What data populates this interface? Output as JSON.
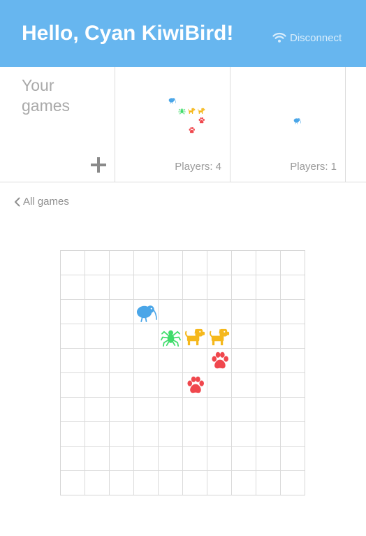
{
  "header": {
    "greeting": "Hello, Cyan KiwiBird!",
    "disconnect_label": "Disconnect",
    "bg_color": "#67b6ef"
  },
  "your_games": {
    "label": "Your games",
    "add_icon": "plus-icon"
  },
  "games": [
    {
      "players_label": "Players: 4",
      "pieces": [
        {
          "icon": "kiwi-bird-icon",
          "color": "#4aa6e8",
          "row": 2,
          "col": 3
        },
        {
          "icon": "spider-icon",
          "color": "#3fdc6a",
          "row": 3,
          "col": 4
        },
        {
          "icon": "dog-icon",
          "color": "#f5b81c",
          "row": 3,
          "col": 5
        },
        {
          "icon": "dog-icon",
          "color": "#f5b81c",
          "row": 3,
          "col": 6
        },
        {
          "icon": "paw-icon",
          "color": "#f0474d",
          "row": 4,
          "col": 6
        },
        {
          "icon": "paw-icon",
          "color": "#f0474d",
          "row": 5,
          "col": 5
        }
      ]
    },
    {
      "players_label": "Players: 1",
      "pieces": [
        {
          "icon": "kiwi-bird-icon",
          "color": "#4aa6e8",
          "row": 4,
          "col": 4
        }
      ]
    }
  ],
  "nav": {
    "back_label": "All games"
  },
  "board": {
    "rows": 10,
    "cols": 10,
    "pieces": [
      {
        "icon": "kiwi-bird-icon",
        "color": "#4aa6e8",
        "row": 2,
        "col": 3
      },
      {
        "icon": "spider-icon",
        "color": "#3fdc6a",
        "row": 3,
        "col": 4
      },
      {
        "icon": "dog-icon",
        "color": "#f5b81c",
        "row": 3,
        "col": 5
      },
      {
        "icon": "dog-icon",
        "color": "#f5b81c",
        "row": 3,
        "col": 6
      },
      {
        "icon": "paw-icon",
        "color": "#f0474d",
        "row": 4,
        "col": 6
      },
      {
        "icon": "paw-icon",
        "color": "#f0474d",
        "row": 5,
        "col": 5
      }
    ]
  }
}
